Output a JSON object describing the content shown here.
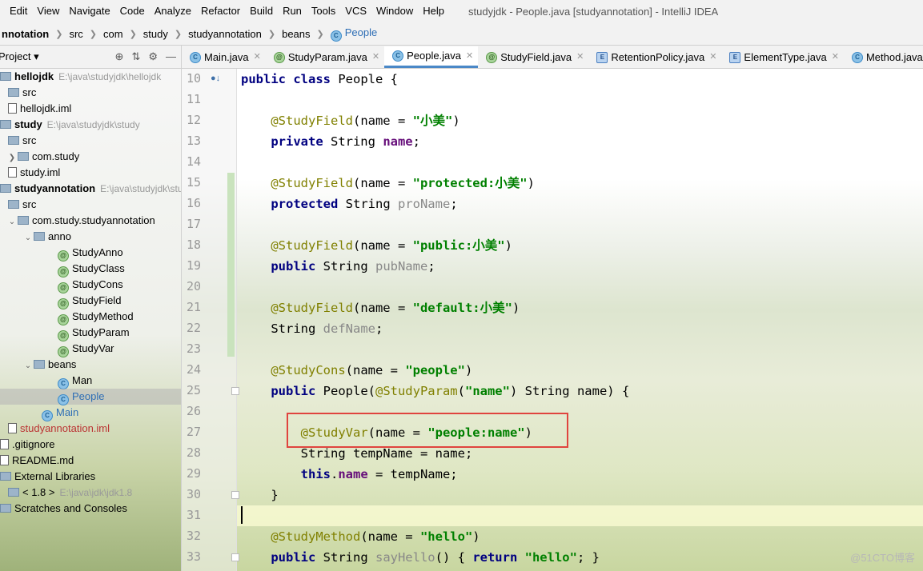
{
  "menu": {
    "items": [
      "Edit",
      "View",
      "Navigate",
      "Code",
      "Analyze",
      "Refactor",
      "Build",
      "Run",
      "Tools",
      "VCS",
      "Window",
      "Help"
    ],
    "window_title": "studyjdk - People.java [studyannotation] - IntelliJ IDEA"
  },
  "breadcrumb": [
    "nnotation",
    "src",
    "com",
    "study",
    "studyannotation",
    "beans",
    "People"
  ],
  "project_panel": {
    "title": "Project",
    "tree": [
      {
        "label": "hellojdk",
        "path": "E:\\java\\studyjdk\\hellojdk",
        "type": "module"
      },
      {
        "label": "src",
        "type": "folder"
      },
      {
        "label": "hellojdk.iml",
        "type": "file"
      },
      {
        "label": "study",
        "path": "E:\\java\\studyjdk\\study",
        "type": "module"
      },
      {
        "label": "src",
        "type": "folder"
      },
      {
        "label": "com.study",
        "type": "package"
      },
      {
        "label": "study.iml",
        "type": "file"
      },
      {
        "label": "studyannotation",
        "path": "E:\\java\\studyjdk\\stu",
        "type": "module"
      },
      {
        "label": "src",
        "type": "folder"
      },
      {
        "label": "com.study.studyannotation",
        "type": "package"
      },
      {
        "label": "anno",
        "type": "package"
      },
      {
        "label": "StudyAnno",
        "type": "annotation"
      },
      {
        "label": "StudyClass",
        "type": "annotation"
      },
      {
        "label": "StudyCons",
        "type": "annotation"
      },
      {
        "label": "StudyField",
        "type": "annotation"
      },
      {
        "label": "StudyMethod",
        "type": "annotation"
      },
      {
        "label": "StudyParam",
        "type": "annotation"
      },
      {
        "label": "StudyVar",
        "type": "annotation"
      },
      {
        "label": "beans",
        "type": "package"
      },
      {
        "label": "Man",
        "type": "class"
      },
      {
        "label": "People",
        "type": "class"
      },
      {
        "label": "Main",
        "type": "class"
      },
      {
        "label": "studyannotation.iml",
        "type": "file"
      },
      {
        "label": ".gitignore",
        "type": "file"
      },
      {
        "label": "README.md",
        "type": "file"
      },
      {
        "label": "External Libraries",
        "type": "lib"
      },
      {
        "label": "< 1.8 >",
        "path": "E:\\java\\jdk\\jdk1.8",
        "type": "lib"
      },
      {
        "label": "Scratches and Consoles",
        "type": "scratch"
      }
    ]
  },
  "tabs": [
    {
      "label": "Main.java",
      "icon": "class-icon"
    },
    {
      "label": "StudyParam.java",
      "icon": "annotation-icon"
    },
    {
      "label": "People.java",
      "icon": "class-icon"
    },
    {
      "label": "StudyField.java",
      "icon": "annotation-icon"
    },
    {
      "label": "RetentionPolicy.java",
      "icon": "enum-icon"
    },
    {
      "label": "ElementType.java",
      "icon": "enum-icon"
    },
    {
      "label": "Method.java",
      "icon": "class-icon"
    }
  ],
  "editor": {
    "line_numbers": [
      "10",
      "11",
      "12",
      "13",
      "14",
      "15",
      "16",
      "17",
      "18",
      "19",
      "20",
      "21",
      "22",
      "23",
      "24",
      "25",
      "26",
      "27",
      "28",
      "29",
      "30",
      "31",
      "32",
      "33"
    ]
  },
  "watermark": "@51CTO博客"
}
